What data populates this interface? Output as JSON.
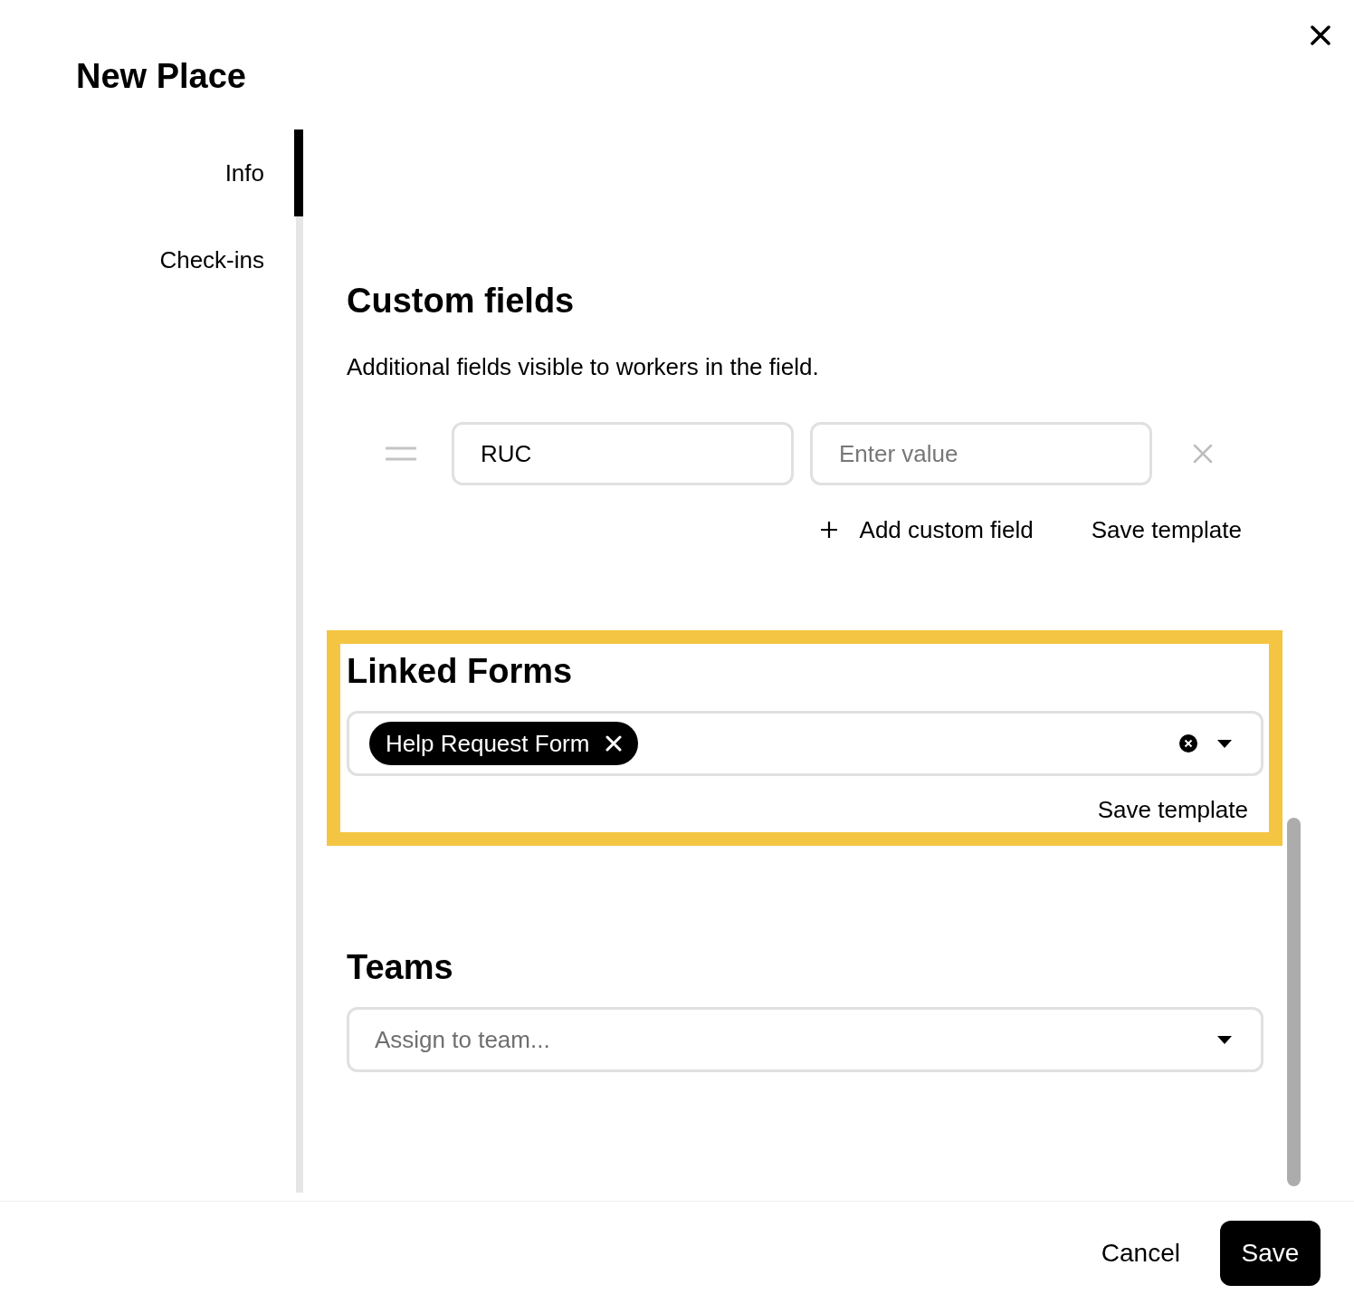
{
  "dialog": {
    "title": "New Place"
  },
  "nav": [
    {
      "label": "Info",
      "selected": true
    },
    {
      "label": "Check-ins",
      "selected": false
    }
  ],
  "custom_fields": {
    "heading": "Custom fields",
    "description": "Additional fields visible to workers in the field.",
    "rows": [
      {
        "name": "RUC",
        "value_placeholder": "Enter value"
      }
    ],
    "add_label": "Add custom field",
    "save_template": "Save template"
  },
  "linked_forms": {
    "heading": "Linked Forms",
    "chips": [
      {
        "label": "Help Request Form"
      }
    ],
    "save_template": "Save template"
  },
  "teams": {
    "heading": "Teams",
    "placeholder": "Assign to team..."
  },
  "footer": {
    "cancel": "Cancel",
    "save": "Save"
  }
}
